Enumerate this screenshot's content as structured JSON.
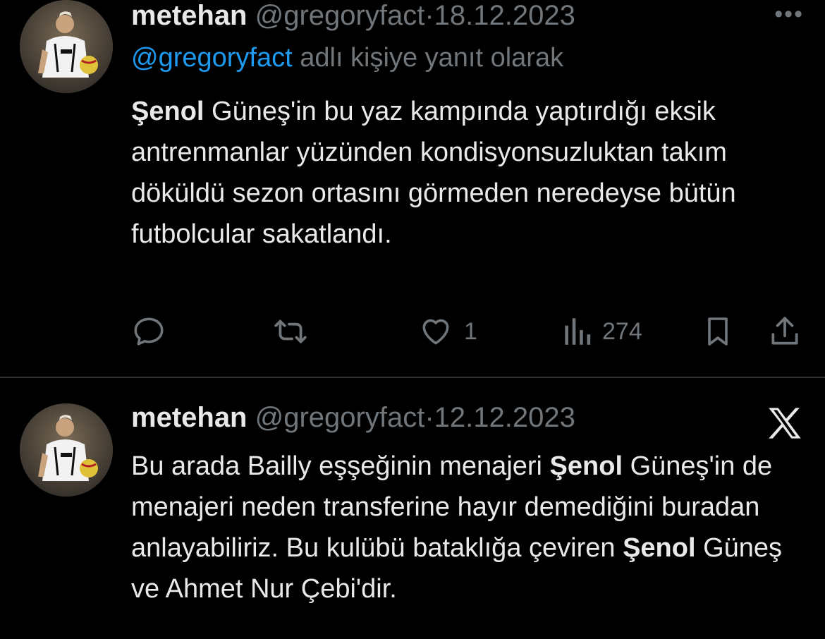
{
  "tweets": [
    {
      "author": {
        "name": "metehan",
        "handle": "@gregoryfact",
        "separator": "·",
        "date": "18.12.2023",
        "avatar": "avatar-footballer"
      },
      "reply_to": {
        "mention": "@gregoryfact",
        "suffix": "adlı kişiye yanıt olarak"
      },
      "text": {
        "bold_lead": "Şenol",
        "rest": " Güneş'in bu yaz kampında yaptırdığı eksik antrenmanlar yüzünden kondisyonsuzluktan takım döküldü sezon ortasını görmeden neredeyse bütün futbolcular sakatlandı."
      },
      "menu_icon": "more-icon",
      "actions": {
        "reply": {
          "icon": "reply-icon",
          "count": ""
        },
        "repost": {
          "icon": "repost-icon",
          "count": ""
        },
        "like": {
          "icon": "heart-icon",
          "count": "1"
        },
        "views": {
          "icon": "views-icon",
          "count": "274"
        },
        "bookmark": {
          "icon": "bookmark-icon"
        },
        "share": {
          "icon": "share-icon"
        }
      }
    },
    {
      "author": {
        "name": "metehan",
        "handle": "@gregoryfact",
        "separator": "·",
        "date": "12.12.2023",
        "avatar": "avatar-footballer"
      },
      "text": {
        "p1": "Bu arada Bailly eşşeğinin menajeri ",
        "b1": "Şenol",
        "p2": " Güneş'in de menajeri neden transferine hayır demediğini buradan anlayabiliriz. Bu kulübü bataklığa çeviren ",
        "b2": "Şenol",
        "p3": " Güneş ve Ahmet Nur Çebi'dir."
      },
      "brand_icon": "x-logo-icon"
    }
  ],
  "colors": {
    "background": "#000000",
    "text": "#e7e9ea",
    "muted": "#71767b",
    "link": "#1d9bf0",
    "divider": "#2f3336"
  }
}
